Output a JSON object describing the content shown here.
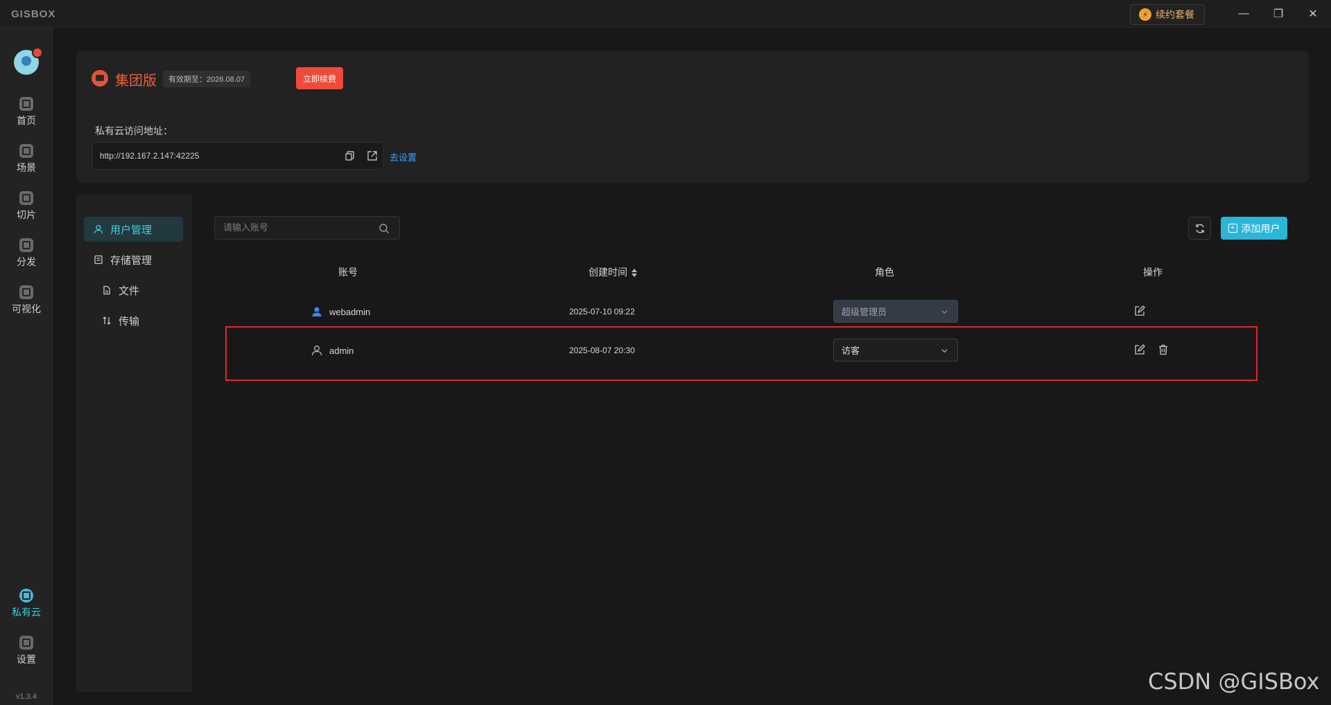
{
  "app": {
    "logo": "GISBOX",
    "version": "v1.3.4"
  },
  "titlebar": {
    "renew_package": "续约套餐",
    "minimize": "—",
    "restore": "❐",
    "close": "✕"
  },
  "rail": {
    "items": [
      {
        "label": "首页",
        "icon": "home-icon"
      },
      {
        "label": "场景",
        "icon": "scene-icon"
      },
      {
        "label": "切片",
        "icon": "slice-icon"
      },
      {
        "label": "分发",
        "icon": "publish-icon"
      },
      {
        "label": "可视化",
        "icon": "visualize-icon"
      }
    ],
    "bottom": [
      {
        "label": "私有云",
        "icon": "private-cloud-icon",
        "active": true
      },
      {
        "label": "设置",
        "icon": "settings-icon"
      }
    ]
  },
  "license": {
    "edition": "集团版",
    "expiry": "有效期至：2026.08.07",
    "renew_now": "立即续费",
    "address_label": "私有云访问地址：",
    "address": "http://192.167.2.147:42225",
    "goto_setting": "去设置"
  },
  "subnav": {
    "items": [
      {
        "label": "用户管理",
        "active": true
      },
      {
        "label": "存储管理"
      },
      {
        "label": "文件"
      },
      {
        "label": "传输"
      }
    ]
  },
  "toolbar": {
    "search_placeholder": "请输入账号",
    "add_user": "添加用户"
  },
  "table": {
    "headers": {
      "account": "账号",
      "created": "创建时间",
      "role": "角色",
      "actions": "操作"
    },
    "rows": [
      {
        "account": "webadmin",
        "created": "2025-07-10 09:22",
        "role": "超级管理员"
      },
      {
        "account": "admin",
        "created": "2025-08-07 20:30",
        "role": "访客"
      }
    ]
  },
  "watermark": "CSDN @GISBox",
  "colors": {
    "accent": "#2bb6d8",
    "danger": "#f04a3a",
    "highlight": "#e0262d"
  }
}
